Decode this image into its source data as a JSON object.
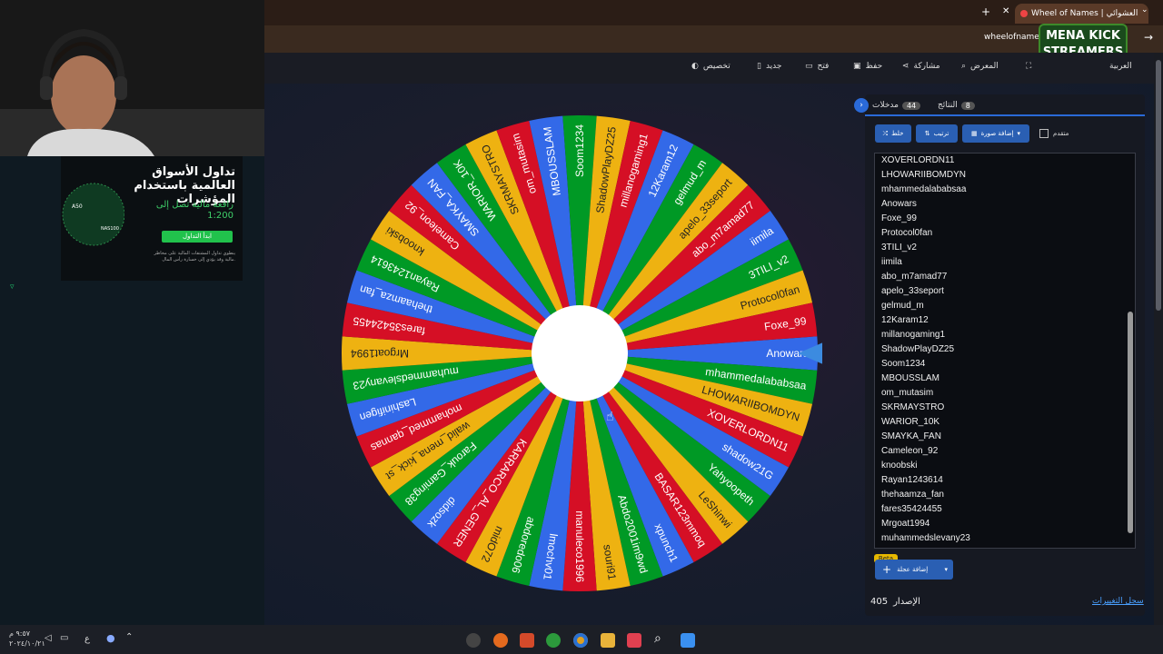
{
  "browser": {
    "tab_title": "Wheel of Names | العشوائي",
    "new_tab_icon": "plus-icon",
    "url": "wheelofnames",
    "logo_text_line1": "MENA KICK",
    "logo_text_line2": "STREAMERS"
  },
  "toolbar": {
    "language": "العربية",
    "gallery": "المعرض",
    "share": "مشاركة",
    "save": "حفظ",
    "open": "فتح",
    "new": "جديد",
    "customize": "تخصيص"
  },
  "panel": {
    "tab_entries_label": "مدخلات",
    "tab_entries_count": "44",
    "tab_results_label": "النتائج",
    "tab_results_count": "8",
    "shuffle_label": "خلط",
    "sort_label": "ترتيب",
    "add_image_label": "إضافة صورة",
    "advanced_label": "متقدم",
    "add_wheel_label": "إضافة عجلة",
    "beta_label": "Beta",
    "version_label": "الإصدار",
    "version_value": "405",
    "changelog_label": "سجل التغييرات"
  },
  "entries": [
    "XOVERLORDN11",
    "LHOWARIIBOMDYN",
    "mhammedalababsaa",
    "Anowars",
    "Foxe_99",
    "Protocol0fan",
    "3TILI_v2",
    "iimila",
    "abo_m7amad77",
    "apelo_33seport",
    "gelmud_m",
    "12Karam12",
    "millanogaming1",
    "ShadowPlayDZ25",
    "Soom1234",
    "MBOUSSLAM",
    "om_mutasim",
    "SKRMAYSTRO",
    "WARIOR_10K",
    "SMAYKA_FAN",
    "Cameleon_92",
    "knoobski",
    "Rayan1243614",
    "thehaamza_fan",
    "fares35424455",
    "Mrgoat1994",
    "muhammedslevany23"
  ],
  "wheel": {
    "segments": [
      "Anowars",
      "mhammedalababsaa",
      "LHOWARIIBOMDYN",
      "XOVERLORDN11",
      "shadow21G",
      "Yahyoopeth",
      "LeShinwi",
      "BASAR123mmoq",
      "xpunch1",
      "Abdo2001im9wd",
      "souri91",
      "manuleco1996",
      "lmochv01",
      "abdoredo06",
      "midO72",
      "KARRARCO_AL_GENER",
      "didsozk",
      "Farouk_Gaming38",
      "walid_mena_kick_st",
      "mohammed_qannas",
      "Lashinifigen",
      "muhammedslevany23",
      "Mrgoat1994",
      "fares35424455",
      "thehaamza_fan",
      "Rayan1243614",
      "knoobski",
      "Cameleon_92",
      "SMAYKA_FAN",
      "WARIOR_10K",
      "SKRMAYSTRO",
      "om_mutasim",
      "MBOUSSLAM",
      "Soom1234",
      "ShadowPlayDZ25",
      "millanogaming1",
      "12Karam12",
      "gelmud_m",
      "apelo_33seport",
      "abo_m7amad77",
      "iimila",
      "3TILI_v2",
      "Protocol0fan",
      "Foxe_99"
    ],
    "colors": [
      "#3369e8",
      "#009925",
      "#eeb211",
      "#d50f25"
    ]
  },
  "ad": {
    "headline": "تداول الأسواق العالمية باستخدام المؤشرات",
    "leverage": "رافعة مالية تصل إلى",
    "ratio": "1:200",
    "cta": "ابدأ التداول",
    "disclaimer": "ينطوي تداول المشتقات المالية على مخاطر مالية وقد يؤدي إلى خسارة رأس المال.",
    "label_a50": "A50",
    "label_nas": "NAS100"
  },
  "taskbar": {
    "time": "٩:٥٧ م",
    "date": "٢٠٢٤/١٠/٢١",
    "lang": "ع"
  }
}
